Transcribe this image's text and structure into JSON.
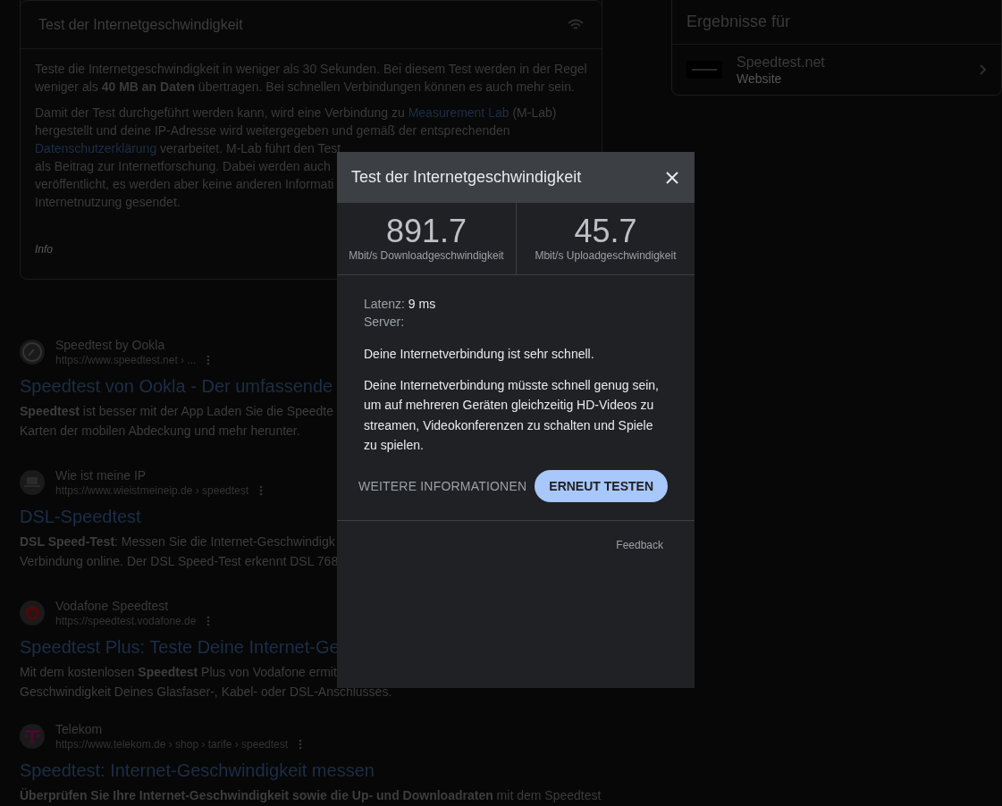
{
  "info_card": {
    "title": "Test der Internetgeschwindigkeit",
    "paragraphs": [
      [
        [
          {
            "text": "Teste die Internetgeschwindigkeit in weniger als 30 Sekunden. Bei diesem Test werden in der Regel"
          }
        ],
        [
          {
            "text": "weniger als **40 MB an Daten** übertragen. Bei schnellen Verbindungen können es auch mehr sein."
          }
        ]
      ],
      [
        [
          {
            "text": "Damit der Test durchgeführt werden kann, wird eine Verbindung zu "
          },
          {
            "text": "Measurement Lab",
            "kind": "link"
          },
          {
            "text": " (M-Lab)"
          }
        ],
        [
          {
            "text": "hergestellt und deine IP-Adresse wird weitergegeben und gemäß der entsprechenden"
          }
        ],
        [
          {
            "text": "Datenschutzerklärung",
            "kind": "link"
          },
          {
            "text": " verarbeitet. M-Lab führt den Test"
          }
        ],
        [
          {
            "text": "als Beitrag zur Internetforschung. Dabei werden auch"
          }
        ],
        [
          {
            "text": "veröffentlicht, es werden aber keine anderen Informati"
          }
        ],
        [
          {
            "text": "Internetnutzung gesendet."
          }
        ]
      ]
    ],
    "footer": "Info"
  },
  "results_panel": {
    "title": "Ergebnisse für",
    "item": {
      "name": "Speedtest.net",
      "type": "Website"
    }
  },
  "results": [
    {
      "site": "Speedtest by Ookla",
      "url": "https://www.speedtest.net › ...",
      "title": "Speedtest von Ookla - Der umfassende",
      "snippet": [
        "**Speedtest** ist besser mit der App Laden Sie die Speedte",
        "Karten der mobilen Abdeckung und mehr herunter."
      ]
    },
    {
      "site": "Wie ist meine IP",
      "url": "https://www.wieistmeineip.de › speedtest",
      "title": "DSL-Speedtest",
      "snippet": [
        "**DSL Speed-Test**: Messen Sie die Internet-Geschwindigk",
        "Verbindung online. Der DSL Speed-Test erkennt DSL 768"
      ]
    },
    {
      "site": "Vodafone Speedtest",
      "url": "https://speedtest.vodafone.de",
      "title": "Speedtest Plus: Teste Deine Internet-Ge",
      "snippet": [
        "Mit dem kostenlosen **Speedtest** Plus von Vodafone ermit",
        "Geschwindigkeit Deines Glasfaser-, Kabel- oder DSL-Anschlusses."
      ]
    },
    {
      "site": "Telekom",
      "url": "https://www.telekom.de › shop › tarife › speedtest",
      "title": "Speedtest: Internet-Geschwindigkeit messen",
      "snippet": [
        "**Überprüfen Sie Ihre Internet-Geschwindigkeit sowie die Up- und Downloadraten** mit dem Speedtest"
      ]
    }
  ],
  "dialog": {
    "title": "Test der Internetgeschwindigkeit",
    "stats": [
      {
        "value": "891.7",
        "label": "Mbit/s Downloadgeschwindigkeit"
      },
      {
        "value": "45.7",
        "label": "Mbit/s Uploadgeschwindigkeit"
      }
    ],
    "latency_label": "Latenz:",
    "latency_value": "9 ms",
    "server_label": "Server:",
    "messages": [
      "Deine Internetverbindung ist sehr schnell.",
      "Deine Internetverbindung müsste schnell genug sein, um auf mehreren Geräten gleichzeitig HD-Videos zu streamen, Videokonferenzen zu schalten und Spiele zu spielen."
    ],
    "more_button": "WEITERE INFORMATIONEN",
    "retest_button": "ERNEUT TESTEN",
    "feedback": "Feedback"
  }
}
